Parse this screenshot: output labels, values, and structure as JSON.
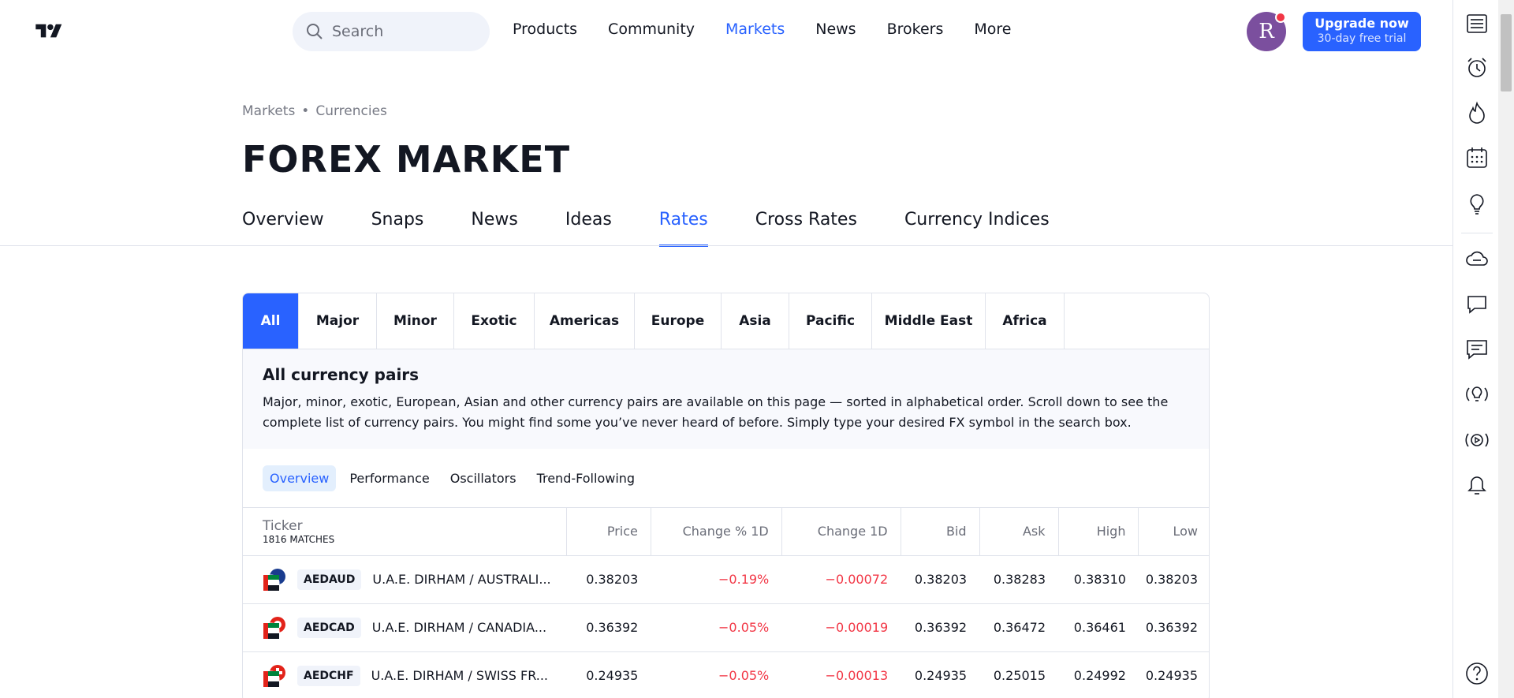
{
  "header": {
    "search_placeholder": "Search",
    "nav": [
      "Products",
      "Community",
      "Markets",
      "News",
      "Brokers",
      "More"
    ],
    "active_nav": "Markets",
    "avatar_letter": "R",
    "upgrade_title": "Upgrade now",
    "upgrade_sub": "30-day free trial"
  },
  "breadcrumb": {
    "first": "Markets",
    "sep": "•",
    "second": "Currencies"
  },
  "page_title": "FOREX MARKET",
  "tabs": [
    "Overview",
    "Snaps",
    "News",
    "Ideas",
    "Rates",
    "Cross Rates",
    "Currency Indices"
  ],
  "active_tab": "Rates",
  "regions": [
    "All",
    "Major",
    "Minor",
    "Exotic",
    "Americas",
    "Europe",
    "Asia",
    "Pacific",
    "Middle East",
    "Africa"
  ],
  "active_region": "All",
  "info": {
    "title": "All currency pairs",
    "text": "Major, minor, exotic, European, Asian and other currency pairs are available on this page — sorted in alphabetical order. Scroll down to see the complete list of currency pairs. You might find some you’ve never heard of before. Simply type your desired FX symbol in the search box."
  },
  "sub_tabs": [
    "Overview",
    "Performance",
    "Oscillators",
    "Trend-Following"
  ],
  "active_sub_tab": "Overview",
  "table": {
    "ticker_header": "Ticker",
    "matches": "1816 MATCHES",
    "columns": [
      "Price",
      "Change % 1D",
      "Change 1D",
      "Bid",
      "Ask",
      "High",
      "Low"
    ],
    "rows": [
      {
        "symbol": "AEDAUD",
        "name": "U.A.E. DIRHAM / AUSTRALI...",
        "price": "0.38203",
        "change_pct": "−0.19%",
        "change": "−0.00072",
        "bid": "0.38203",
        "ask": "0.38283",
        "high": "0.38310",
        "low": "0.38203"
      },
      {
        "symbol": "AEDCAD",
        "name": "U.A.E. DIRHAM / CANADIA...",
        "price": "0.36392",
        "change_pct": "−0.05%",
        "change": "−0.00019",
        "bid": "0.36392",
        "ask": "0.36472",
        "high": "0.36461",
        "low": "0.36392"
      },
      {
        "symbol": "AEDCHF",
        "name": "U.A.E. DIRHAM / SWISS FR...",
        "price": "0.24935",
        "change_pct": "−0.05%",
        "change": "−0.00013",
        "bid": "0.24935",
        "ask": "0.25015",
        "high": "0.24992",
        "low": "0.24935"
      }
    ]
  },
  "colors": {
    "accent": "#2962ff",
    "negative": "#f23645",
    "text": "#131722",
    "muted": "#787b86"
  },
  "right_bar_icons": [
    "watchlist-icon",
    "alarm-clock-icon",
    "hotlist-flame-icon",
    "calendar-icon",
    "ideas-bulb-icon",
    "chat-cloud-icon",
    "messages-icon",
    "chat-icon",
    "ideas-stream-icon",
    "streams-play-icon",
    "notifications-bell-icon",
    "help-icon"
  ]
}
